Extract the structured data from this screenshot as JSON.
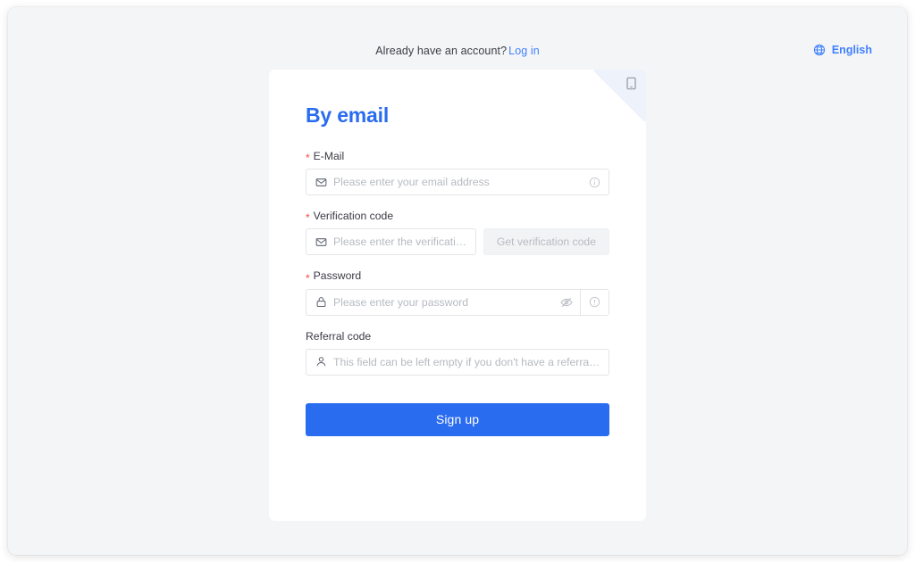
{
  "topbar": {
    "account_prompt": "Already have an account?",
    "login_link": "Log in",
    "language": "English",
    "globe_icon": "globe-icon"
  },
  "card": {
    "title": "By email",
    "corner_badge_icon": "mobile-phone-icon",
    "fields": {
      "email": {
        "label": "E-Mail",
        "required_mark": "*",
        "placeholder": "Please enter your email address",
        "value": "",
        "lead_icon": "envelope-icon",
        "trail_icon": "info-circle-icon"
      },
      "verification": {
        "label": "Verification code",
        "required_mark": "*",
        "placeholder": "Please enter the verification ...",
        "value": "",
        "lead_icon": "envelope-icon",
        "button_label": "Get verification code"
      },
      "password": {
        "label": "Password",
        "required_mark": "*",
        "placeholder": "Please enter your password",
        "value": "",
        "lead_icon": "lock-icon",
        "toggle_icon": "eye-slash-icon",
        "addon_icon": "info-circle-icon"
      },
      "referral": {
        "label": "Referral code",
        "placeholder": "This field can be left empty if you don't have a referral c...",
        "value": "",
        "lead_icon": "user-icon"
      }
    },
    "submit_label": "Sign up"
  },
  "colors": {
    "accent": "#2a6cf0",
    "link": "#4080ff",
    "required": "#f5483b",
    "page_bg": "#f4f5f6",
    "card_bg": "#ffffff",
    "ribbon": "#eef2fa",
    "placeholder": "#b6bac0",
    "disabled_btn_bg": "#f2f3f5"
  }
}
